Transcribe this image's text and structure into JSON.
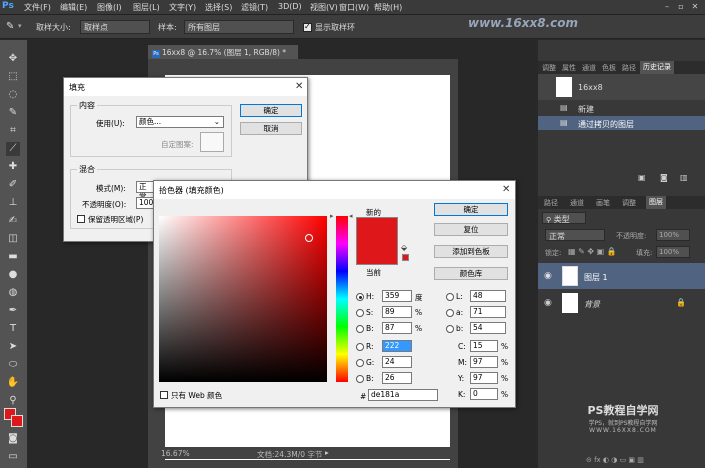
{
  "menubar": {
    "logo": "Ps",
    "items": [
      "文件(F)",
      "编辑(E)",
      "图像(I)",
      "图层(L)",
      "文字(Y)",
      "选择(S)",
      "滤镜(T)",
      "3D(D)",
      "视图(V)",
      "窗口(W)",
      "帮助(H)"
    ]
  },
  "options": {
    "sample_size_label": "取样大小:",
    "sample_size_value": "取样点",
    "sample_label": "样本:",
    "sample_value": "所有图层",
    "show_ring_label": "显示取样环"
  },
  "watermark": "www.16xx8.com",
  "document": {
    "tab_title": "16xx8 @ 16.7% (图层 1, RGB/8) *",
    "zoom": "16.67%",
    "doc_info": "文档:24.3M/0 字节"
  },
  "history_panel": {
    "tabs": [
      "调整",
      "属性",
      "通道",
      "色板",
      "路径",
      "历史记录"
    ],
    "snapshot": "16xx8",
    "items": [
      "新建",
      "通过拷贝的图层"
    ]
  },
  "layers_panel": {
    "tabs": [
      "路径",
      "通道",
      "画笔",
      "调整",
      "图层"
    ],
    "filter_label": "类型",
    "blend_mode": "正常",
    "opacity_label": "不透明度:",
    "opacity": "100%",
    "lock_label": "锁定:",
    "fill_label": "填充:",
    "fill": "100%",
    "layers": [
      {
        "name": "图层 1"
      },
      {
        "name": "背景"
      }
    ]
  },
  "fill_dialog": {
    "title": "填充",
    "ok": "确定",
    "cancel": "取消",
    "content_group": "内容",
    "use_label": "使用(U):",
    "use_value": "颜色...",
    "custom_pattern_label": "自定图案:",
    "blend_group": "混合",
    "mode_label": "模式(M):",
    "mode_value": "正常",
    "opacity_label": "不透明度(O):",
    "opacity_value": "100",
    "preserve_label": "保留透明区域(P)"
  },
  "color_picker": {
    "title": "拾色器 (填充颜色)",
    "new_label": "新的",
    "current_label": "当前",
    "buttons": {
      "ok": "确定",
      "reset": "复位",
      "add_swatch": "添加到色板",
      "libraries": "颜色库"
    },
    "hsb": {
      "H": "359",
      "S": "89",
      "B": "87",
      "H_unit": "度",
      "S_unit": "%",
      "B_unit": "%"
    },
    "rgb": {
      "R": "222",
      "G": "24",
      "B": "26"
    },
    "lab": {
      "L": "48",
      "a": "71",
      "b": "54"
    },
    "cmyk": {
      "C": "15",
      "M": "97",
      "Y": "97",
      "K": "0"
    },
    "hex": "de181a",
    "web_only_label": "只有 Web 颜色",
    "labels": {
      "H": "H:",
      "S": "S:",
      "Bv": "B:",
      "R": "R:",
      "G": "G:",
      "Bb": "B:",
      "L": "L:",
      "a": "a:",
      "b": "b:",
      "C": "C:",
      "M": "M:",
      "Y": "Y:",
      "K": "K:",
      "hash": "#"
    }
  },
  "brand": {
    "name": "PS教程自学网",
    "slogan": "学PS，就到PS教程自学网",
    "url": "WWW.16XX8.COM"
  },
  "colors": {
    "picked": "#de181a",
    "accent_blue": "#0078d7"
  }
}
